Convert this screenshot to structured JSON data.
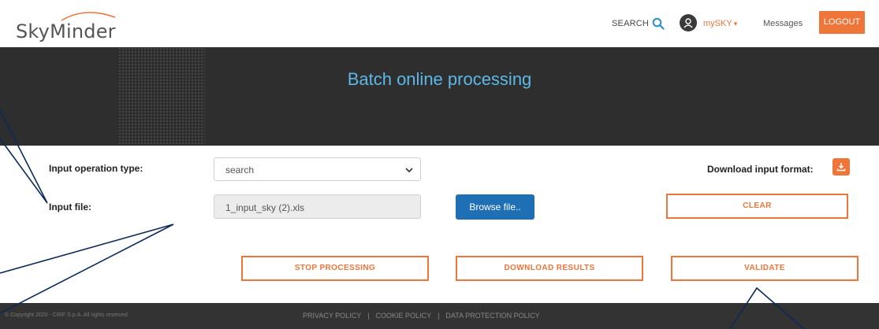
{
  "header": {
    "logo_text": "SkyMinder",
    "search_label": "SEARCH",
    "user_label": "mySKY",
    "messages_label": "Messages",
    "logout_label": "LOGOUT"
  },
  "banner": {
    "title": "Batch online processing"
  },
  "form": {
    "operation_type_label": "Input operation type:",
    "operation_type_value": "search",
    "input_file_label": "Input file:",
    "input_file_value": "1_input_sky (2).xls",
    "browse_label": "Browse file..",
    "download_format_label": "Download input format:",
    "clear_label": "CLEAR",
    "stop_label": "STOP PROCESSING",
    "download_results_label": "DOWNLOAD RESULTS",
    "validate_label": "VALIDATE"
  },
  "footer": {
    "copyright": "© Copyright 2020 - CRIF S.p.A. All rights reserved",
    "links": [
      "PRIVACY POLICY",
      "COOKIE POLICY",
      "DATA PROTECTION POLICY"
    ]
  },
  "colors": {
    "accent": "#f07538",
    "primary_button": "#1f6fb5",
    "banner_bg": "#2e2e2e",
    "banner_title": "#5cb8e6",
    "footer_bg": "#333333",
    "callout_line": "#0b2a5a"
  }
}
